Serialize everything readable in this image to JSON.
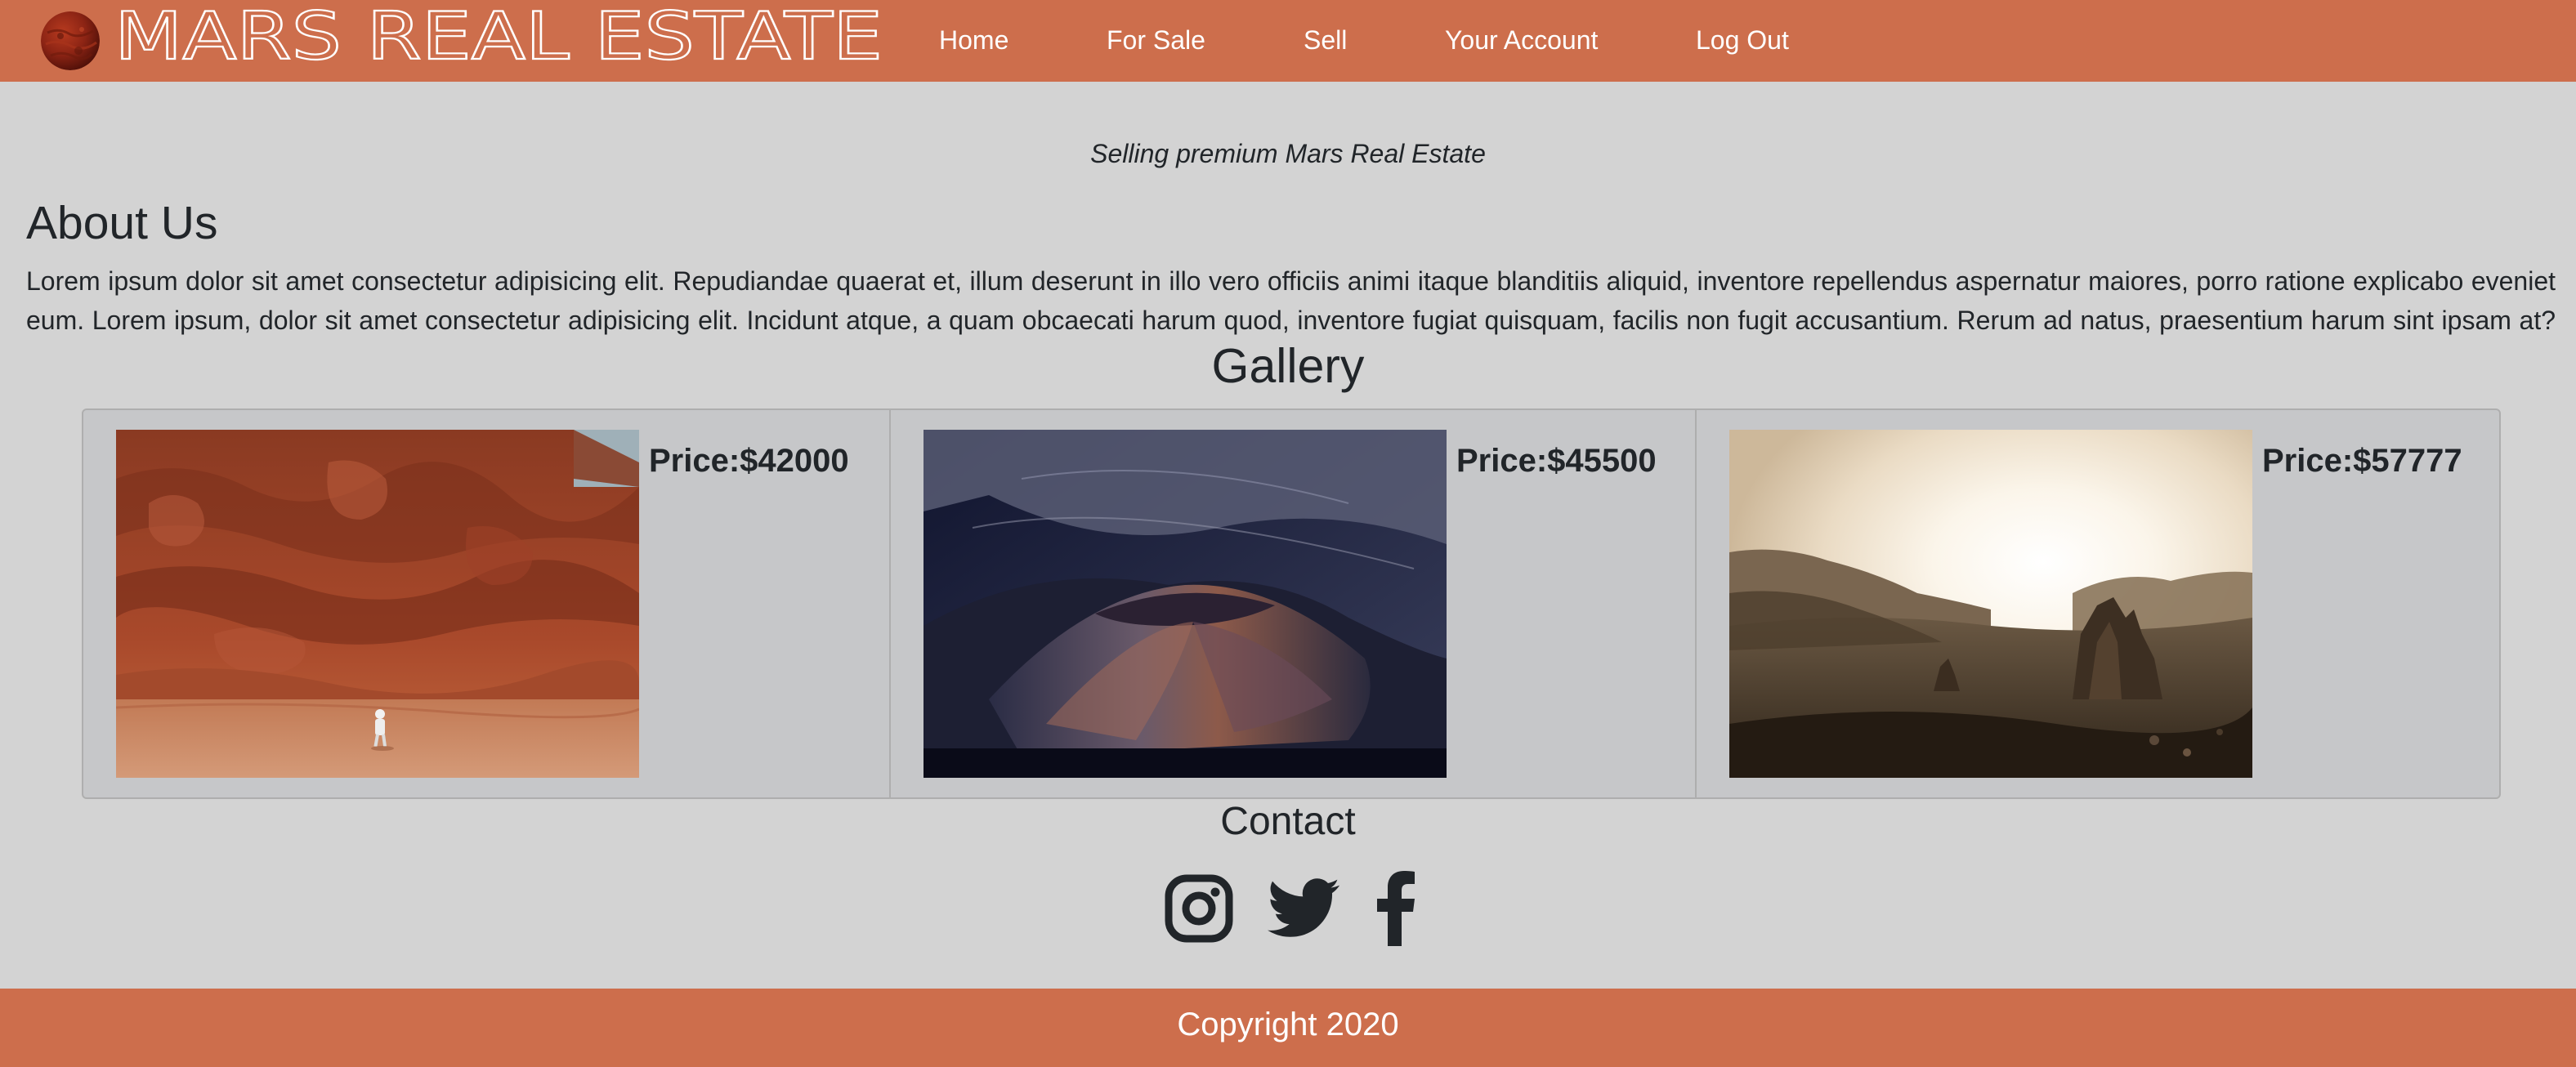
{
  "brand": {
    "name": "MARS REAL ESTATE",
    "logo_icon": "mars-planet-icon"
  },
  "nav": {
    "items": [
      {
        "label": "Home"
      },
      {
        "label": "For Sale"
      },
      {
        "label": "Sell"
      },
      {
        "label": "Your Account"
      },
      {
        "label": "Log Out"
      }
    ]
  },
  "hero": {
    "tagline": "Selling premium Mars Real Estate"
  },
  "about": {
    "heading": "About Us",
    "lines": [
      "Lorem ipsum dolor sit amet consectetur adipisicing elit. Repudiandae quaerat et, illum deserunt in illo vero officiis animi itaque blanditiis aliquid, inventore repellendus aspernatur maiores, porro ratione explicabo eveniet",
      "eum. Lorem ipsum, dolor sit amet consectetur adipisicing elit. Incidunt atque, a quam obcaecati harum quod, inventore fugiat quisquam, facilis non fugit accusantium. Rerum ad natus, praesentium harum sint ipsam at?"
    ]
  },
  "gallery": {
    "heading": "Gallery",
    "items": [
      {
        "price": "Price:$42000"
      },
      {
        "price": "Price:$45500"
      },
      {
        "price": "Price:$57777"
      }
    ]
  },
  "contact": {
    "heading": "Contact",
    "icons": [
      "instagram-icon",
      "twitter-icon",
      "facebook-icon"
    ]
  },
  "footer": {
    "text": "Copyright 2020"
  },
  "colors": {
    "brand": "#cd6e4c",
    "page_background": "#d3d3d3",
    "card_background": "#c6c7c9",
    "text": "#212529"
  }
}
